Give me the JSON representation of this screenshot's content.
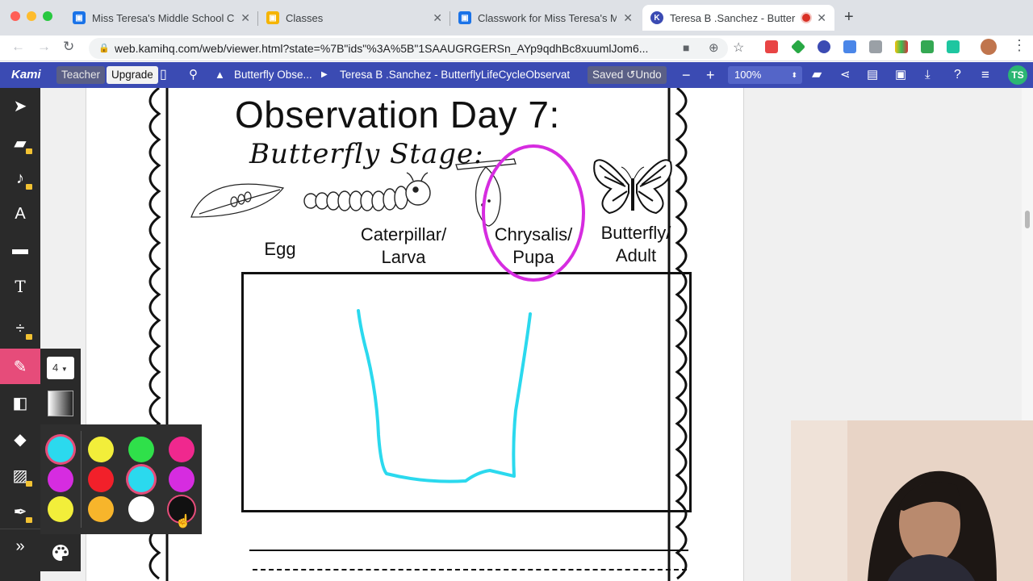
{
  "browser": {
    "tabs": [
      {
        "title": "Miss Teresa's Middle School Cl",
        "favicon_color": "#1a73e8"
      },
      {
        "title": "Classes",
        "favicon_color": "#f5b400"
      },
      {
        "title": "Classwork for Miss Teresa's Mi",
        "favicon_color": "#1a73e8"
      },
      {
        "title": "Teresa B .Sanchez - Butter",
        "favicon_color": "#3b4bb3"
      }
    ],
    "url": "web.kamihq.com/web/viewer.html?state=%7B\"ids\"%3A%5B\"1SAAUGRGERSn_AYp9qdhBc8xuumlJom6..."
  },
  "kami": {
    "logo": "Kami",
    "teacher_label": "Teacher",
    "upgrade_label": "Upgrade",
    "breadcrumb_folder": "Butterfly Obse...",
    "doc_title": "Teresa B .Sanchez - ButterflyLifeCycleObservat",
    "saved_label": "Saved",
    "undo_label": "Undo",
    "zoom": "100%",
    "user_initials": "TS"
  },
  "pen_size": "4",
  "palette": {
    "colors": [
      "#2bd9ee",
      "#f2ee3a",
      "#2fe04a",
      "#f0288e",
      "#d62ce0",
      "#f2202a",
      "#2bd9ee",
      "#d62ce0",
      "#f2ee3a",
      "#f7b52b",
      "#ffffff",
      "#111111"
    ],
    "selected_index": 0
  },
  "worksheet": {
    "title": "Observation Day 7:",
    "subtitle": "Butterfly Stage:",
    "stages": [
      {
        "line1": "Egg",
        "line2": ""
      },
      {
        "line1": "Caterpillar/",
        "line2": "Larva"
      },
      {
        "line1": "Chrysalis/",
        "line2": "Pupa"
      },
      {
        "line1": "Butterfly/",
        "line2": "Adult"
      }
    ],
    "circled_stage_index": 2,
    "circle_color": "#d62ce0",
    "drawing_color": "#2bd9ee"
  }
}
